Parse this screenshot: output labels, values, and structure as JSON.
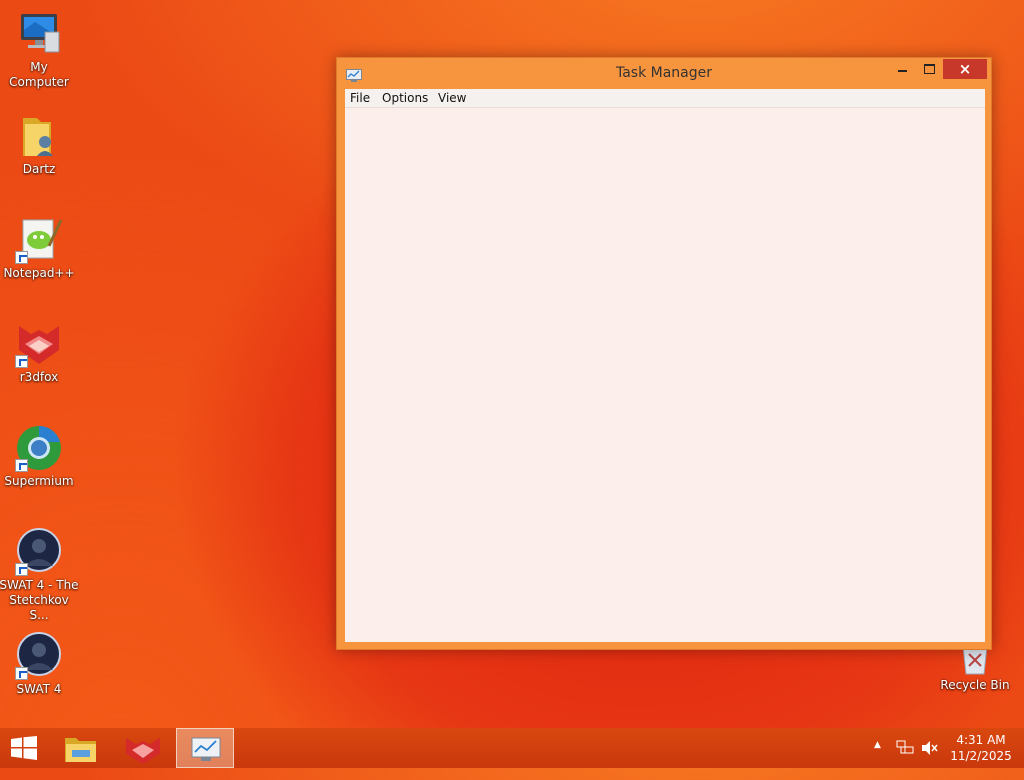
{
  "desktop": {
    "icons": [
      {
        "label": "My Computer"
      },
      {
        "label": "Dartz"
      },
      {
        "label": "Notepad++"
      },
      {
        "label": "r3dfox"
      },
      {
        "label": "Supermium"
      },
      {
        "label": "SWAT 4 - The Stetchkov S..."
      },
      {
        "label": "SWAT 4"
      }
    ],
    "recycle_bin": {
      "label": "Recycle Bin"
    }
  },
  "window": {
    "title": "Task Manager",
    "close_glyph": "×",
    "menu": [
      {
        "label": "File"
      },
      {
        "label": "Options"
      },
      {
        "label": "View"
      }
    ]
  },
  "taskbar": {
    "time": "4:31 AM",
    "date": "11/2/2025",
    "tray_arrow": "▲"
  },
  "colors": {
    "accent": "#f7953e",
    "close": "#c7382a",
    "taskbar": "#d6410f"
  }
}
